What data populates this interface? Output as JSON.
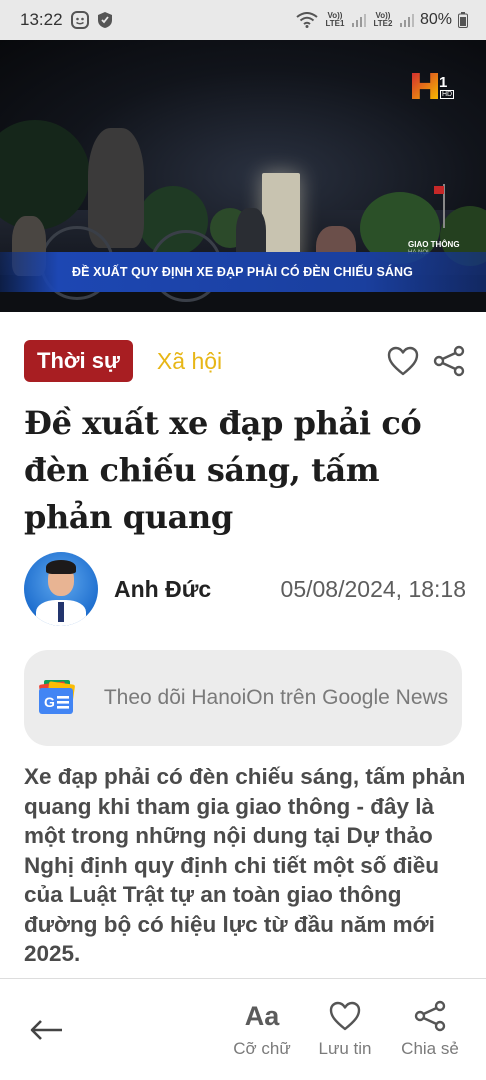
{
  "status_bar": {
    "time": "13:22",
    "sim1": "Vo)) LTE1",
    "sim2": "Vo)) LTE2",
    "battery": "80%"
  },
  "hero": {
    "channel_logo": "H1",
    "channel_hd": "HD",
    "lower_third": "ĐỀ XUẤT QUY ĐỊNH XE ĐẠP PHẢI CÓ ĐÈN CHIẾU SÁNG",
    "program_tag": "GIAO THÔNG",
    "program_sub": "HÀ NỘI"
  },
  "article": {
    "category_primary": "Thời sự",
    "category_secondary": "Xã hội",
    "title": "Đề xuất xe đạp phải có đèn chiếu sáng, tấm phản quang",
    "author": "Anh Đức",
    "published": "05/08/2024, 18:18",
    "follow_text": "Theo dõi HanoiOn trên Google News",
    "lead": "Xe đạp phải có đèn chiếu sáng, tấm phản quang khi tham gia giao thông - đây là một trong những nội dung tại Dự thảo Nghị định quy định chi tiết một số điều của Luật Trật tự an toàn giao thông đường bộ có hiệu lực từ đầu năm mới 2025."
  },
  "bottom_bar": {
    "font_glyph": "Aa",
    "font_label": "Cỡ chữ",
    "save_label": "Lưu tin",
    "share_label": "Chia sẻ"
  },
  "colors": {
    "category_primary_bg": "#a81e22",
    "category_secondary": "#e7b617",
    "lower_third_bg": "#1d47b3"
  },
  "icons": [
    "heart-icon",
    "share-icon",
    "back-arrow-icon",
    "google-news-icon",
    "wifi-icon",
    "battery-icon"
  ]
}
